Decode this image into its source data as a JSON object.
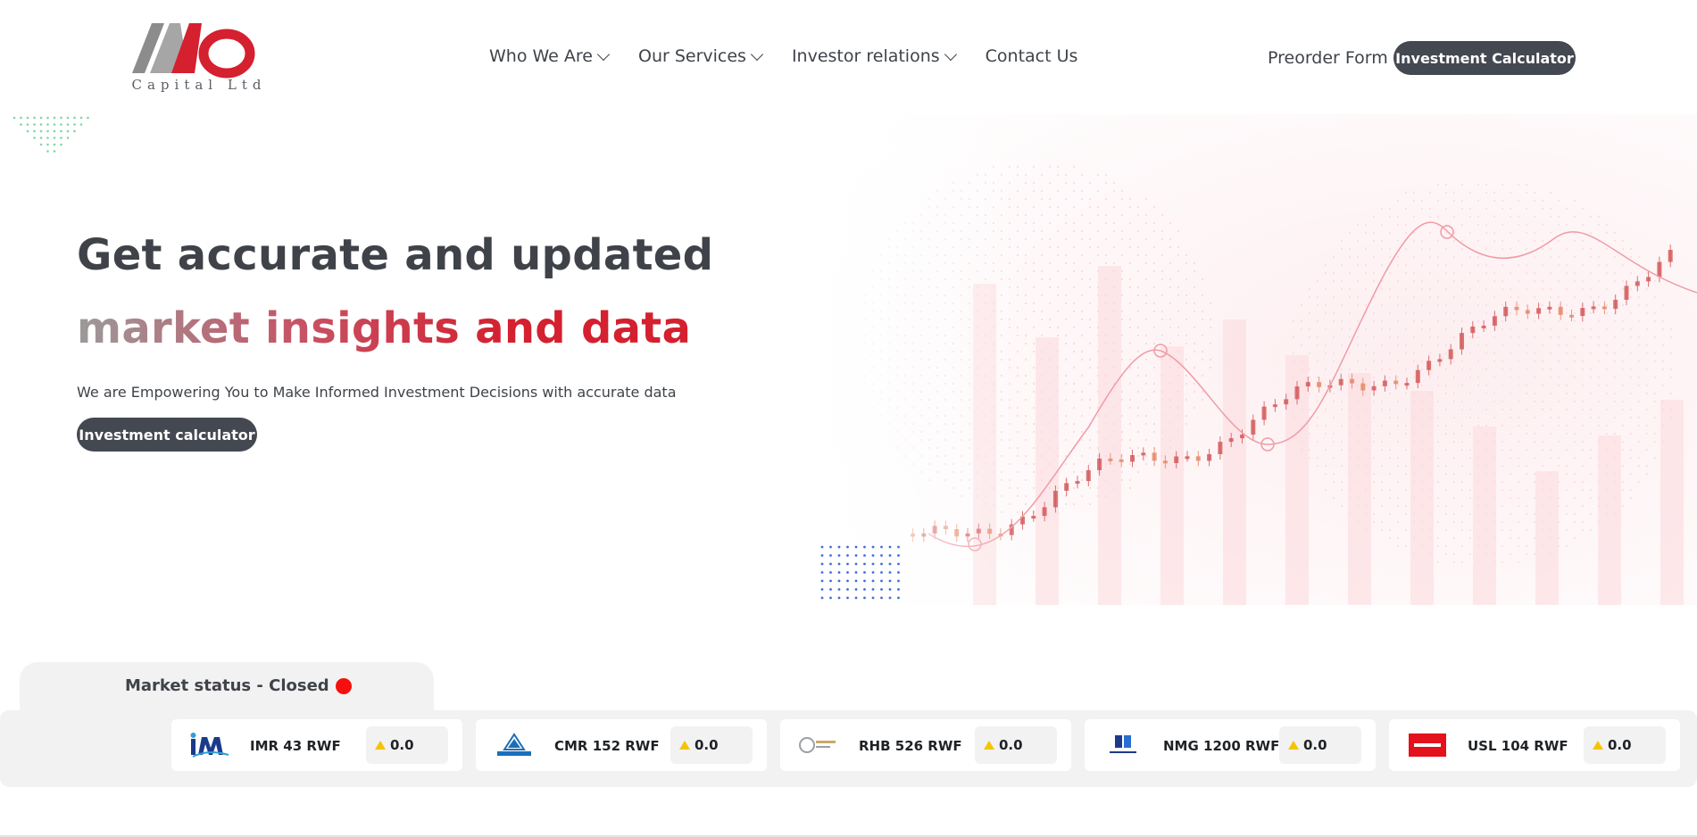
{
  "brand": {
    "logo_text": "Capital Ltd",
    "logo_letters": "MO",
    "colors": {
      "red": "#d4202f",
      "dark": "#434851",
      "grey": "#9b9a9a"
    }
  },
  "nav": {
    "items": [
      {
        "label": "Who We Are",
        "has_dropdown": true
      },
      {
        "label": "Our Services",
        "has_dropdown": true
      },
      {
        "label": "Investor relations",
        "has_dropdown": true
      },
      {
        "label": "Contact Us",
        "has_dropdown": false
      }
    ],
    "preorder_label": "Preorder Form",
    "calculator_label": "Investment Calculator"
  },
  "hero": {
    "headline_line1": "Get accurate and updated",
    "headline_line2": "market insights and data",
    "subtitle": "We are Empowering You to Make Informed Investment Decisions with accurate data",
    "cta_label": "Investment calculator"
  },
  "market": {
    "status_label": "Market status - Closed",
    "status_color": "#f60f0f",
    "tickers": [
      {
        "label": "IMR 43 RWF",
        "change": "0.0",
        "logo": "im-logo"
      },
      {
        "label": "CMR 152 RWF",
        "change": "0.0",
        "logo": "cimerwa-logo"
      },
      {
        "label": "RHB 526 RWF",
        "change": "0.0",
        "logo": "rh-bophelo-logo"
      },
      {
        "label": "NMG 1200 RWF",
        "change": "0.0",
        "logo": "nation-media-logo"
      },
      {
        "label": "USL 104 RWF",
        "change": "0.0",
        "logo": "uchumi-logo"
      }
    ]
  }
}
